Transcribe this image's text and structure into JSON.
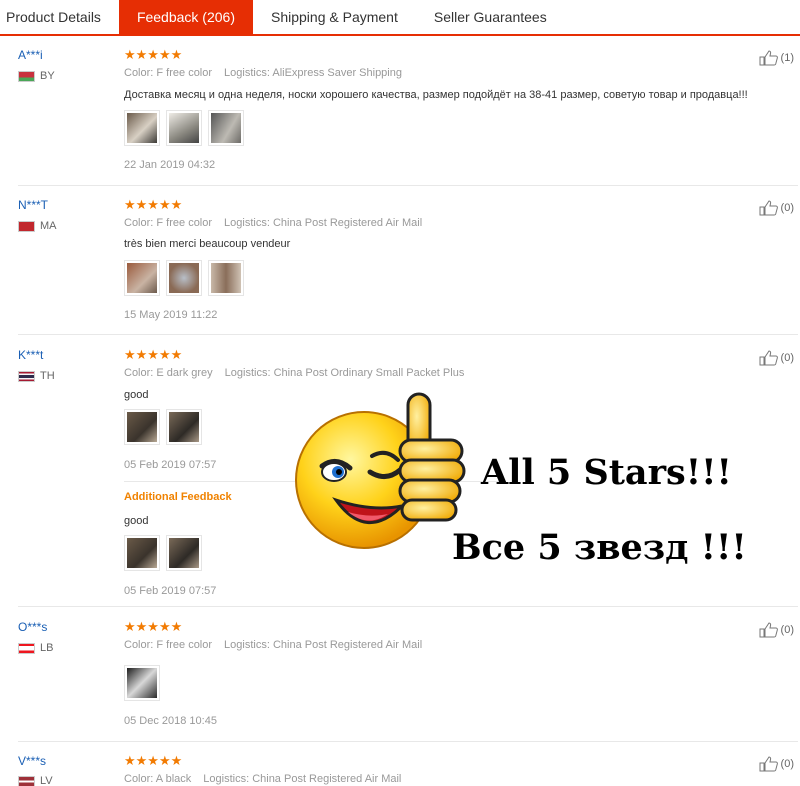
{
  "tabs": [
    {
      "label": "Product Details",
      "active": false
    },
    {
      "label": "Feedback (206)",
      "active": true
    },
    {
      "label": "Shipping & Payment",
      "active": false
    },
    {
      "label": "Seller Guarantees",
      "active": false
    }
  ],
  "labels": {
    "color": "Color:",
    "logistics": "Logistics:",
    "additional_feedback": "Additional Feedback"
  },
  "rating_stars": 5,
  "reviews": [
    {
      "user": "A***i",
      "country": "BY",
      "flag_colors": [
        "#c8313e",
        "#4aa657"
      ],
      "color": "F free color",
      "logistics": "AliExpress Saver Shipping",
      "text": "Доставка месяц и одна неделя, носки хорошего качества, размер подойдёт на 38-41 размер, советую товар и продавца!!!",
      "date": "22 Jan 2019 04:32",
      "helpful": "(1)",
      "photos": 3
    },
    {
      "user": "N***T",
      "country": "MA",
      "flag_colors": [
        "#c1272d",
        "#c1272d"
      ],
      "color": "F free color",
      "logistics": "China Post Registered Air Mail",
      "text": "très bien merci beaucoup vendeur",
      "date": "15 May 2019 11:22",
      "helpful": "(0)",
      "photos": 3
    },
    {
      "user": "K***t",
      "country": "TH",
      "flag_colors": [
        "#a51931",
        "#2d2a4a"
      ],
      "color": "E dark grey",
      "logistics": "China Post Ordinary Small Packet Plus",
      "text": "good",
      "date": "05 Feb 2019 07:57",
      "helpful": "(0)",
      "photos": 2,
      "additional": {
        "text": "good",
        "date": "05 Feb 2019 07:57",
        "photos": 2
      }
    },
    {
      "user": "O***s",
      "country": "LB",
      "flag_colors": [
        "#ee161f",
        "#ffffff"
      ],
      "color": "F free color",
      "logistics": "China Post Registered Air Mail",
      "text": "",
      "date": "05 Dec 2018 10:45",
      "helpful": "(0)",
      "photos": 1
    },
    {
      "user": "V***s",
      "country": "LV",
      "flag_colors": [
        "#9e3039",
        "#ffffff"
      ],
      "color": "A black",
      "logistics": "China Post Registered Air Mail",
      "text": "",
      "date": "",
      "helpful": "(0)",
      "photos": 0
    }
  ],
  "promo": {
    "line_en": "All 5 Stars!!!",
    "line_ru": "Все 5 звезд !!!",
    "icon": "thumbs-up-wink-smiley-icon"
  },
  "colors": {
    "accent": "#e62e04",
    "star": "#f27b02",
    "user_link": "#1a5fb4",
    "additional_feedback": "#f08200"
  }
}
